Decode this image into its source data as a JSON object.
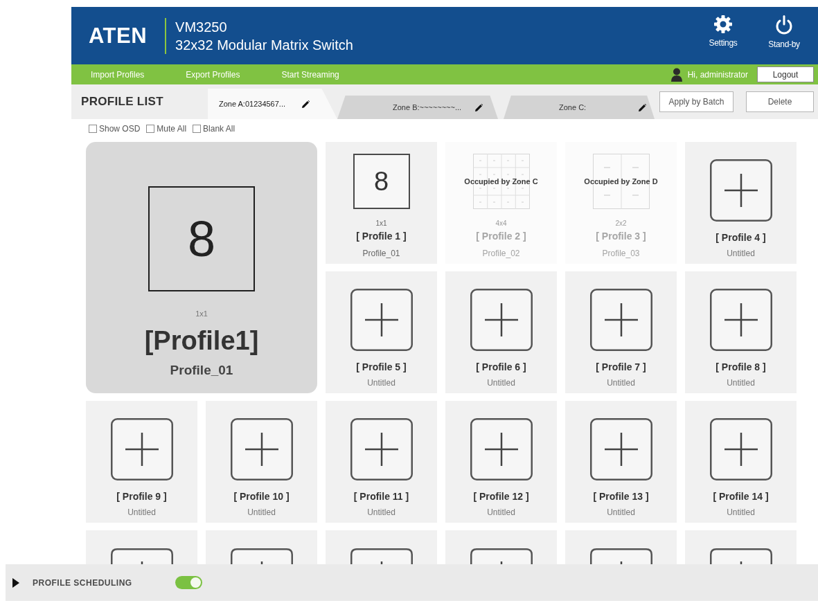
{
  "header": {
    "logo": "ATEN",
    "model": "VM3250",
    "product": "32x32 Modular Matrix Switch",
    "actions": [
      {
        "kind": "settings",
        "label": "Settings"
      },
      {
        "kind": "power",
        "label": "Stand-by"
      }
    ]
  },
  "menu_bar": {
    "links": [
      "Import Profiles",
      "Export Profiles",
      "Start Streaming"
    ],
    "greeting": "Hi, administrator",
    "logout": "Logout"
  },
  "profile_bar": {
    "title": "PROFILE LIST",
    "zones": [
      {
        "label": "Zone A:01234567...",
        "selected": true
      },
      {
        "label": "Zone B:~~~~~~~~...",
        "selected": false
      },
      {
        "label": "Zone C:",
        "selected": false
      }
    ],
    "buttons": [
      "Apply by Batch",
      "Delete"
    ]
  },
  "options": [
    {
      "label": "Show OSD",
      "checked": false
    },
    {
      "label": "Mute All",
      "checked": false
    },
    {
      "label": "Blank All",
      "checked": false
    }
  ],
  "preview": {
    "number": "8",
    "layout": "1x1",
    "title": "[Profile1]",
    "name": "Profile_01"
  },
  "tiles": [
    {
      "kind": "layout",
      "number": "8",
      "layout": "1x1",
      "title": "[ Profile 1 ]",
      "name": "Profile_01"
    },
    {
      "kind": "occupied",
      "grid": {
        "kind": "sixteen"
      },
      "notice": "Occupied by Zone C",
      "layout": "4x4",
      "title": "[ Profile 2 ]",
      "name": "Profile_02"
    },
    {
      "kind": "occupied",
      "grid": {
        "kind": "quad"
      },
      "notice": "Occupied by Zone D",
      "layout": "2x2",
      "title": "[ Profile 3 ]",
      "name": "Profile_03"
    },
    {
      "kind": "empty",
      "title": "[ Profile 4 ]",
      "name": "Untitled"
    },
    {
      "kind": "empty",
      "title": "[ Profile 5 ]",
      "name": "Untitled"
    },
    {
      "kind": "empty",
      "title": "[ Profile 6 ]",
      "name": "Untitled"
    },
    {
      "kind": "empty",
      "title": "[ Profile 7 ]",
      "name": "Untitled"
    },
    {
      "kind": "empty",
      "title": "[ Profile 8 ]",
      "name": "Untitled"
    },
    {
      "kind": "empty",
      "title": "[ Profile 9 ]",
      "name": "Untitled"
    },
    {
      "kind": "empty",
      "title": "[ Profile 10 ]",
      "name": "Untitled"
    },
    {
      "kind": "empty",
      "title": "[ Profile 11 ]",
      "name": "Untitled"
    },
    {
      "kind": "empty",
      "title": "[ Profile 12 ]",
      "name": "Untitled"
    },
    {
      "kind": "empty",
      "title": "[ Profile 13 ]",
      "name": "Untitled"
    },
    {
      "kind": "empty",
      "title": "[ Profile 14 ]",
      "name": "Untitled"
    },
    {
      "kind": "partial"
    },
    {
      "kind": "partial"
    },
    {
      "kind": "partial"
    },
    {
      "kind": "partial"
    },
    {
      "kind": "partial"
    },
    {
      "kind": "partial"
    }
  ],
  "footer": {
    "title": "PROFILE SCHEDULING",
    "expanded": false,
    "toggle_on": true
  }
}
